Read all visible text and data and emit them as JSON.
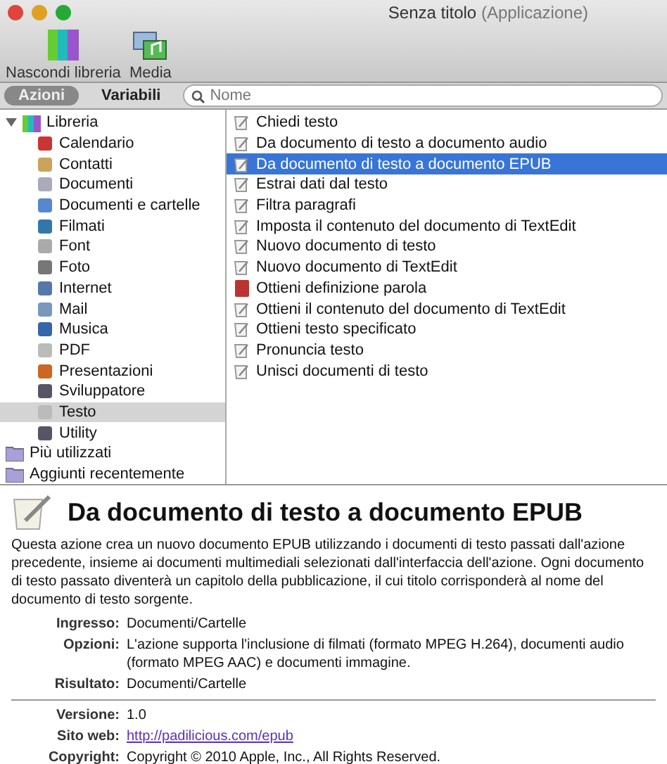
{
  "window": {
    "title": "Senza titolo",
    "subtitle": "(Applicazione)"
  },
  "toolbar": [
    {
      "label": "Nascondi libreria",
      "kind": "library"
    },
    {
      "label": "Media",
      "kind": "media"
    }
  ],
  "tabs": [
    {
      "label": "Azioni",
      "selected": true
    },
    {
      "label": "Variabili",
      "selected": false
    }
  ],
  "search": {
    "placeholder": "Nome"
  },
  "sidebar": {
    "items": [
      {
        "label": "Libreria",
        "kind": "library",
        "expanded": true,
        "selected": false,
        "children": [
          {
            "label": "Calendario",
            "selected": false
          },
          {
            "label": "Contatti",
            "selected": false
          },
          {
            "label": "Documenti",
            "selected": false
          },
          {
            "label": "Documenti e cartelle",
            "selected": false
          },
          {
            "label": "Filmati",
            "selected": false
          },
          {
            "label": "Font",
            "selected": false
          },
          {
            "label": "Foto",
            "selected": false
          },
          {
            "label": "Internet",
            "selected": false
          },
          {
            "label": "Mail",
            "selected": false
          },
          {
            "label": "Musica",
            "selected": false
          },
          {
            "label": "PDF",
            "selected": false
          },
          {
            "label": "Presentazioni",
            "selected": false
          },
          {
            "label": "Sviluppatore",
            "selected": false
          },
          {
            "label": "Testo",
            "selected": true
          },
          {
            "label": "Utility",
            "selected": false
          }
        ]
      },
      {
        "label": "Più utilizzati",
        "kind": "folder",
        "selected": false
      },
      {
        "label": "Aggiunti recentemente",
        "kind": "folder",
        "selected": false
      }
    ]
  },
  "actions": [
    {
      "label": "Chiedi testo",
      "kind": "text",
      "selected": false
    },
    {
      "label": "Da documento di testo a documento audio",
      "kind": "text",
      "selected": false
    },
    {
      "label": "Da documento di testo a documento EPUB",
      "kind": "text",
      "selected": true
    },
    {
      "label": "Estrai dati dal testo",
      "kind": "text",
      "selected": false
    },
    {
      "label": "Filtra paragrafi",
      "kind": "text",
      "selected": false
    },
    {
      "label": "Imposta il contenuto del documento di TextEdit",
      "kind": "text",
      "selected": false
    },
    {
      "label": "Nuovo documento di testo",
      "kind": "text",
      "selected": false
    },
    {
      "label": "Nuovo documento di TextEdit",
      "kind": "text",
      "selected": false
    },
    {
      "label": "Ottieni definizione parola",
      "kind": "dictionary",
      "selected": false
    },
    {
      "label": "Ottieni il contenuto del documento di TextEdit",
      "kind": "text",
      "selected": false
    },
    {
      "label": "Ottieni testo specificato",
      "kind": "text",
      "selected": false
    },
    {
      "label": "Pronuncia testo",
      "kind": "text",
      "selected": false
    },
    {
      "label": "Unisci documenti di testo",
      "kind": "text",
      "selected": false
    }
  ],
  "detail": {
    "title": "Da documento di testo a documento EPUB",
    "description": "Questa azione crea un nuovo documento EPUB utilizzando i documenti di testo passati dall'azione precedente, insieme ai documenti multimediali selezionati dall'interfaccia dell'azione. Ogni documento di testo passato diventerà un capitolo della pubblicazione, il cui titolo corrisponderà al nome del documento di testo sorgente.",
    "fields": [
      {
        "label": "Ingresso:",
        "value": "Documenti/Cartelle"
      },
      {
        "label": "Opzioni:",
        "value": "L'azione supporta l'inclusione di filmati (formato MPEG H.264), documenti audio (formato MPEG AAC) e documenti immagine."
      },
      {
        "label": "Risultato:",
        "value": "Documenti/Cartelle"
      }
    ],
    "meta": [
      {
        "label": "Versione:",
        "value": "1.0",
        "kind": "text"
      },
      {
        "label": "Sito web:",
        "value": "http://padilicious.com/epub",
        "kind": "link"
      },
      {
        "label": "Copyright:",
        "value": "Copyright © 2010 Apple, Inc., All Rights Reserved.",
        "kind": "text"
      }
    ]
  }
}
